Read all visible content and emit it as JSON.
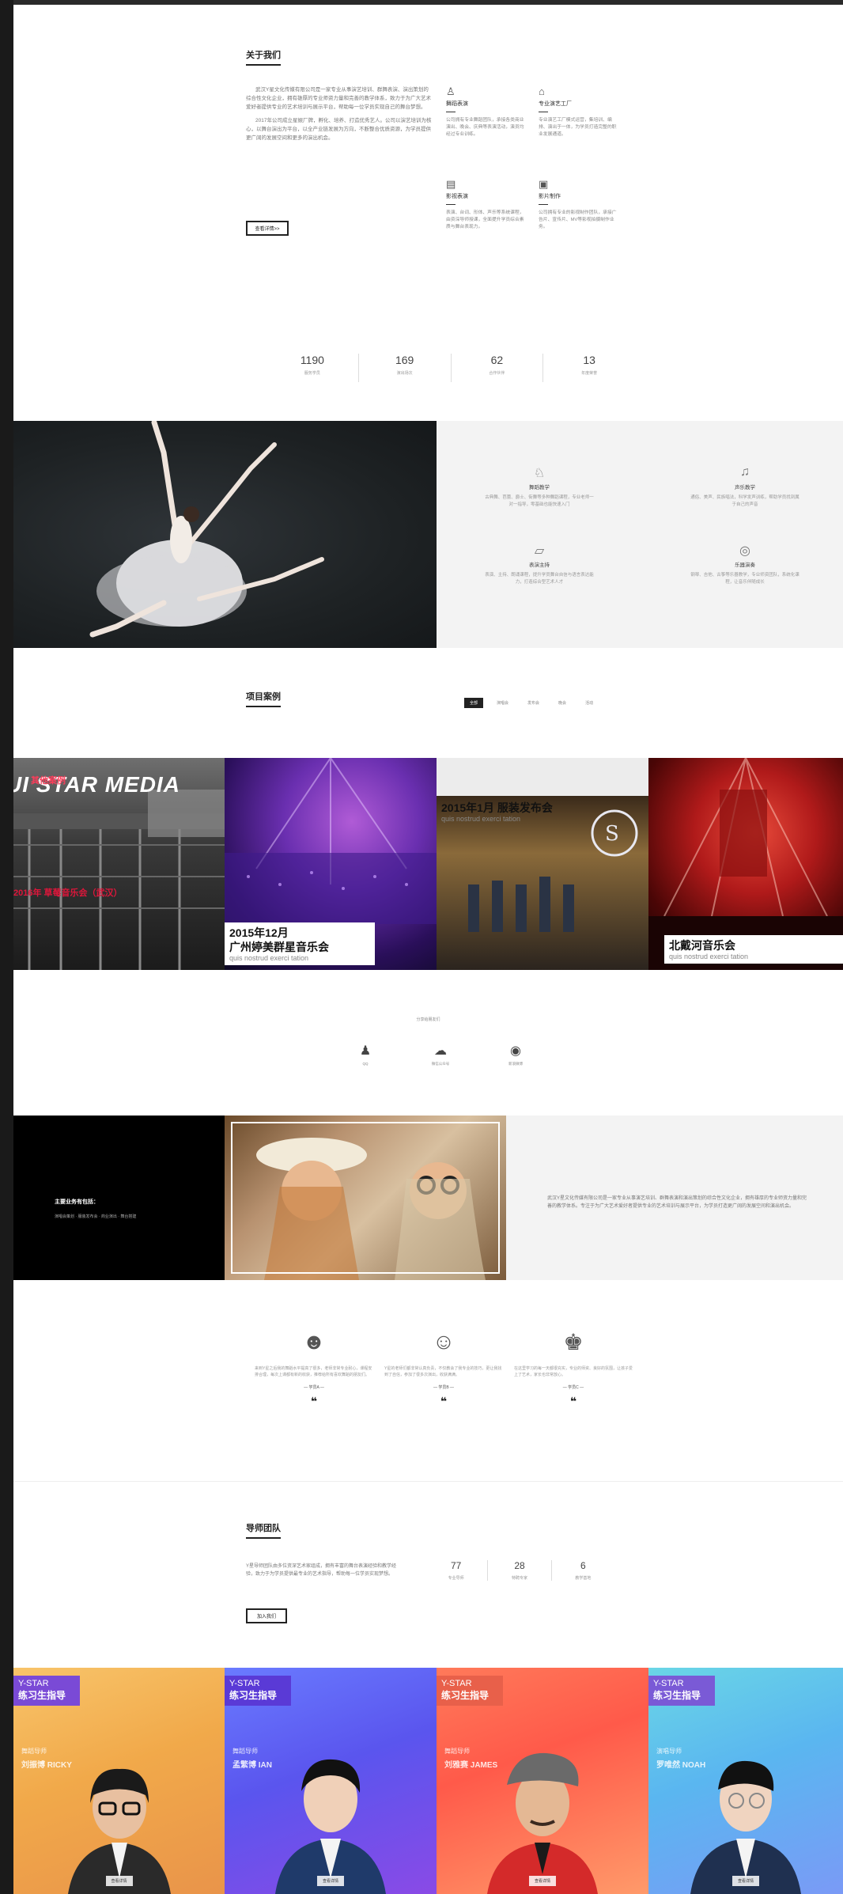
{
  "about": {
    "title": "关于我们",
    "paragraphs": [
      "武汉Y星文化传媒有限公司是一家专业从事演艺培训、群舞表演、演出策划的综合性文化企业，拥有雄厚的专业师资力量和完善的教学体系，致力于为广大艺术爱好者提供专业的艺术培训与展示平台，帮助每一位学员实现自己的舞台梦想。",
      "2017年公司成立星娱厂牌，孵化、培养、打造优秀艺人。公司以演艺培训为核心，以舞台演出为平台，以全产业链发展为方向，不断整合优质资源，为学员提供更广阔的发展空间和更多的演出机会。"
    ],
    "button": "查看详情>>",
    "features": [
      {
        "icon": "music-stand-icon",
        "title": "舞蹈表演",
        "desc": "公司拥有专业舞蹈团队，承接各类商业演出、晚会、庆典等表演活动，演员均经过专业训练。"
      },
      {
        "icon": "factory-icon",
        "title": "专业演艺工厂",
        "desc": "专业演艺工厂模式运营，集培训、编排、演出于一体，为学员打造完整的职业发展通道。"
      },
      {
        "icon": "camera-icon",
        "title": "影视表演",
        "desc": "表演、台词、形体、声乐等系统课程，由资深导师授课，全面提升学员综合素质与舞台表现力。"
      },
      {
        "icon": "film-icon",
        "title": "影片制作",
        "desc": "公司拥有专业的影视制作团队，承接广告片、宣传片、MV等影视拍摄制作业务。"
      }
    ]
  },
  "stats": [
    {
      "value": "1190",
      "label": "服务学员"
    },
    {
      "value": "169",
      "label": "演出场次"
    },
    {
      "value": "62",
      "label": "合作伙伴"
    },
    {
      "value": "13",
      "label": "年度荣誉"
    }
  ],
  "services": [
    {
      "icon": "dance-icon",
      "title": "舞蹈教学",
      "desc": "古典舞、芭蕾、爵士、街舞等多种舞蹈课程，专业老师一对一指导，零基础也能快速入门"
    },
    {
      "icon": "music-icon",
      "title": "声乐教学",
      "desc": "通俗、美声、民族唱法，科学发声训练，帮助学员找到属于自己的声音"
    },
    {
      "icon": "stage-icon",
      "title": "表演主持",
      "desc": "表演、主持、朗诵课程，提升学员舞台自信与语言表达能力，打造综合型艺术人才"
    },
    {
      "icon": "piano-icon",
      "title": "乐器演奏",
      "desc": "钢琴、吉他、古筝等乐器教学，专业师资团队，系统化课程，让音乐伴随成长"
    }
  ],
  "projects": {
    "title": "项目案例",
    "tabs": [
      "全部",
      "演唱会",
      "发布会",
      "晚会",
      "活动"
    ],
    "cases": [
      {
        "overlay": "UI STAR MEDIA",
        "tag": "其他案例",
        "title": "2016年 草莓音乐会（武汉）",
        "subtitle": ""
      },
      {
        "title": "2015年12月",
        "title2": "广州婷美群星音乐会",
        "subtitle": "quis nostrud exerci tation"
      },
      {
        "title": "2015年1月 服装发布会",
        "subtitle": "quis nostrud exerci tation"
      },
      {
        "title": "北戴河音乐会",
        "subtitle": "quis nostrud exerci tation"
      }
    ]
  },
  "share": {
    "label": "分享给朋友们",
    "items": [
      {
        "icon": "qq-icon",
        "label": "QQ"
      },
      {
        "icon": "wechat-icon",
        "label": "微信公众号"
      },
      {
        "icon": "weibo-icon",
        "label": "新浪微博"
      }
    ]
  },
  "fashion": {
    "heading": "主要业务有包括：",
    "sub": "演唱会策划 · 服装发布会 · 商业演出 · 舞台搭建",
    "text": "武汉Y星文化传媒有限公司是一家专业从事演艺培训、群舞表演和演出策划的综合性文化企业，拥有雄厚的专业师资力量和完善的教学体系。专注于为广大艺术爱好者提供专业的艺术培训与展示平台，为学员打造更广阔的发展空间和演出机会。"
  },
  "testimonials": [
    {
      "icon": "bearded-man-icon",
      "text": "来到Y星之后我的舞蹈水平提高了很多，老师非常专业耐心，课程安排合理，每次上课都有新的收获，推荐给所有喜欢舞蹈的朋友们。",
      "name": "— 学员A —"
    },
    {
      "icon": "woman-icon",
      "text": "Y星的老师们都非常认真负责，不仅教会了我专业的技巧，更让我找到了自信，参加了很多次演出，收获满满。",
      "name": "— 学员B —"
    },
    {
      "icon": "user-group-icon",
      "text": "在这里学习的每一天都很充实，专业的师资、良好的氛围，让孩子爱上了艺术，家长也非常放心。",
      "name": "— 学员C —"
    }
  ],
  "team": {
    "title": "导师团队",
    "text": "Y星导师团队由多位资深艺术家组成，拥有丰富的舞台表演经验和教学经验，致力于为学员提供最专业的艺术指导，帮助每一位学员实现梦想。",
    "button": "加入我们",
    "stats": [
      {
        "value": "77",
        "label": "专业导师"
      },
      {
        "value": "28",
        "label": "特聘专家"
      },
      {
        "value": "6",
        "label": "教学基地"
      }
    ],
    "posters": [
      {
        "tag1": "Y-STAR",
        "tag2": "练习生指导",
        "role": "舞蹈导师",
        "name": "刘振博 RICKY",
        "button": "查看详情"
      },
      {
        "tag1": "Y-STAR",
        "tag2": "练习生指导",
        "role": "舞蹈导师",
        "name": "孟繁博 IAN",
        "button": "查看详情"
      },
      {
        "tag1": "Y-STAR",
        "tag2": "练习生指导",
        "role": "舞蹈导师",
        "name": "刘雅赛 JAMES",
        "button": "查看详情"
      },
      {
        "tag1": "Y-STAR",
        "tag2": "练习生指导",
        "role": "演唱导师",
        "name": "罗唯然 NOAH",
        "button": "查看详情"
      }
    ]
  }
}
